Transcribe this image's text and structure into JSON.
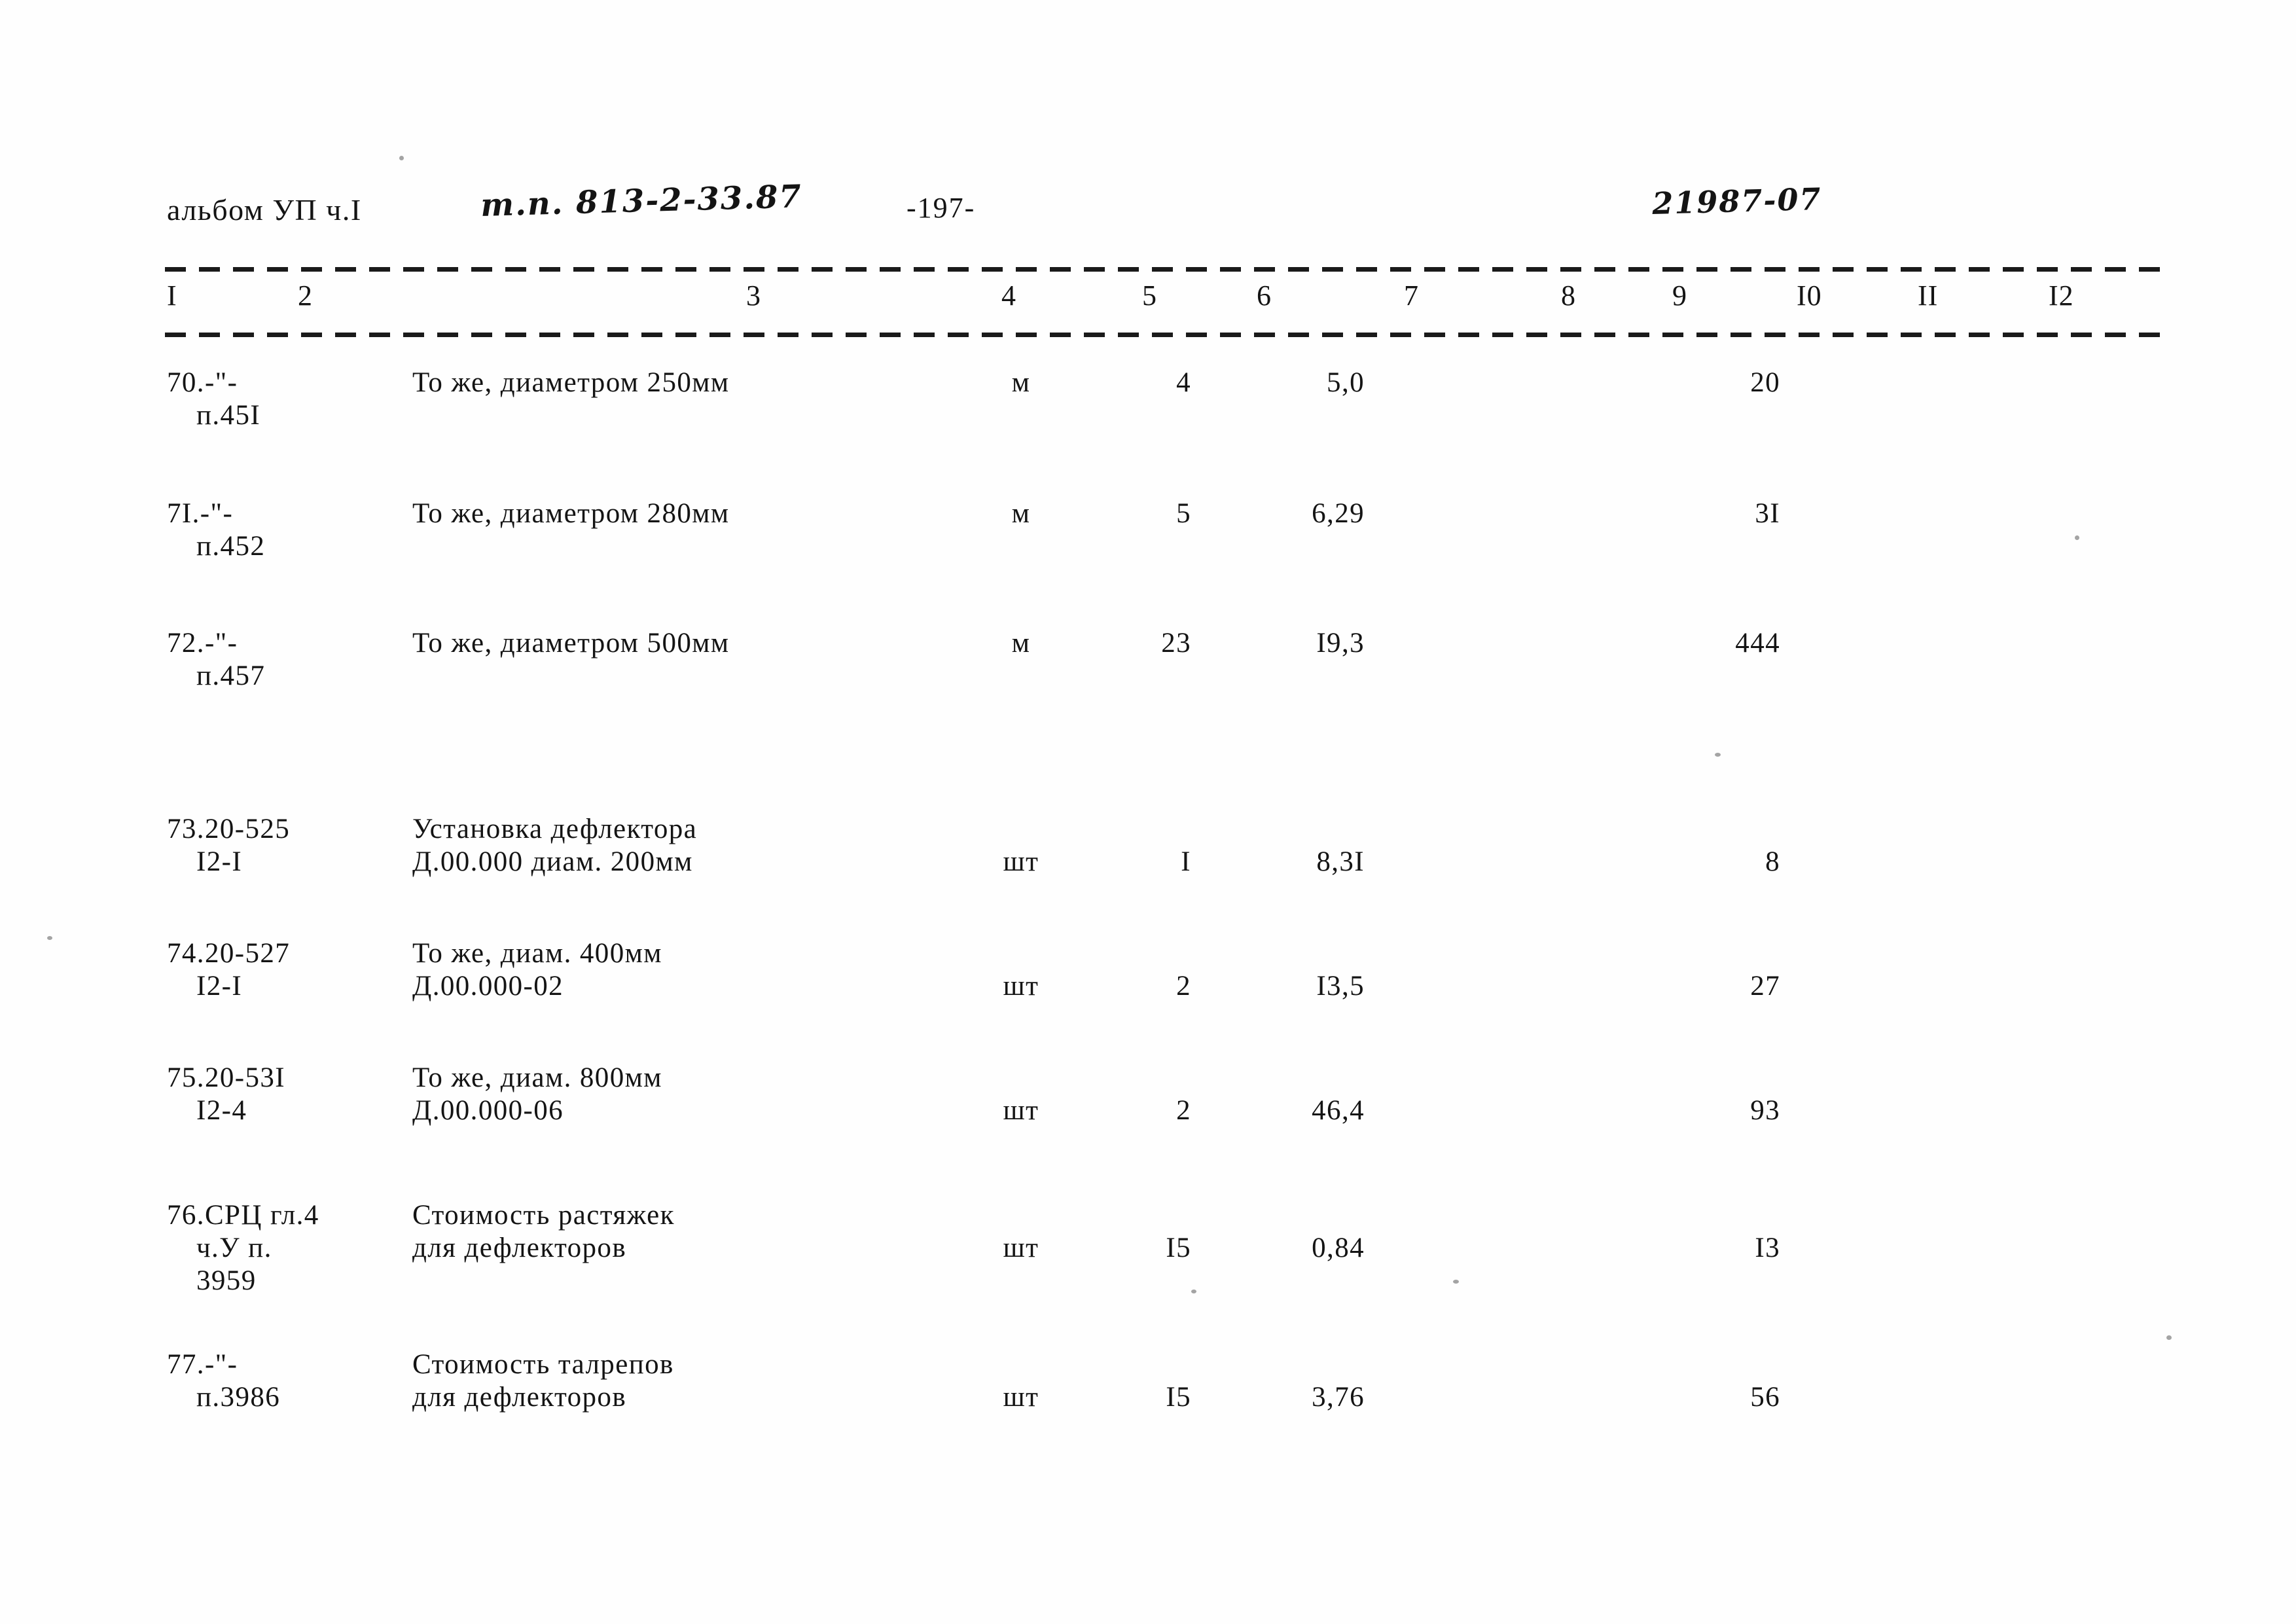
{
  "header": {
    "album": "альбом УП ч.I",
    "type_project": "т.п. 813-2-33.87",
    "page_number": "-197-",
    "doc_code": "21987-07"
  },
  "table": {
    "column_numbers": [
      "I",
      "2",
      "3",
      "4",
      "5",
      "6",
      "7",
      "8",
      "9",
      "I0",
      "II",
      "I2"
    ],
    "rows": [
      {
        "code_line1": "70.-\"-",
        "code_line2": "п.45I",
        "code_line3": "",
        "desc_line1": "То же, диаметром 250мм",
        "desc_line2": "",
        "unit": "м",
        "quantity": "4",
        "price": "5,0",
        "total": "20"
      },
      {
        "code_line1": "7I.-\"-",
        "code_line2": "п.452",
        "code_line3": "",
        "desc_line1": "То же, диаметром 280мм",
        "desc_line2": "",
        "unit": "м",
        "quantity": "5",
        "price": "6,29",
        "total": "3I"
      },
      {
        "code_line1": "72.-\"-",
        "code_line2": "п.457",
        "code_line3": "",
        "desc_line1": "То же, диаметром 500мм",
        "desc_line2": "",
        "unit": "м",
        "quantity": "23",
        "price": "I9,3",
        "total": "444"
      },
      {
        "code_line1": "73.20-525",
        "code_line2": "I2-I",
        "code_line3": "",
        "desc_line1": "Установка дефлектора",
        "desc_line2": "Д.00.000 диам. 200мм",
        "unit": "шт",
        "quantity": "I",
        "price": "8,3I",
        "total": "8"
      },
      {
        "code_line1": "74.20-527",
        "code_line2": "I2-I",
        "code_line3": "",
        "desc_line1": "То же, диам. 400мм",
        "desc_line2": "Д.00.000-02",
        "unit": "шт",
        "quantity": "2",
        "price": "I3,5",
        "total": "27"
      },
      {
        "code_line1": "75.20-53I",
        "code_line2": "I2-4",
        "code_line3": "",
        "desc_line1": "То же, диам. 800мм",
        "desc_line2": "Д.00.000-06",
        "unit": "шт",
        "quantity": "2",
        "price": "46,4",
        "total": "93"
      },
      {
        "code_line1": "76.СРЦ гл.4",
        "code_line2": "ч.У п.",
        "code_line3": "3959",
        "desc_line1": "Стоимость растяжек",
        "desc_line2": "для дефлекторов",
        "unit": "шт",
        "quantity": "I5",
        "price": "0,84",
        "total": "I3"
      },
      {
        "code_line1": "77.-\"-",
        "code_line2": "п.3986",
        "code_line3": "",
        "desc_line1": "Стоимость талрепов",
        "desc_line2": "для дефлекторов",
        "unit": "шт",
        "quantity": "I5",
        "price": "3,76",
        "total": "56"
      }
    ]
  }
}
